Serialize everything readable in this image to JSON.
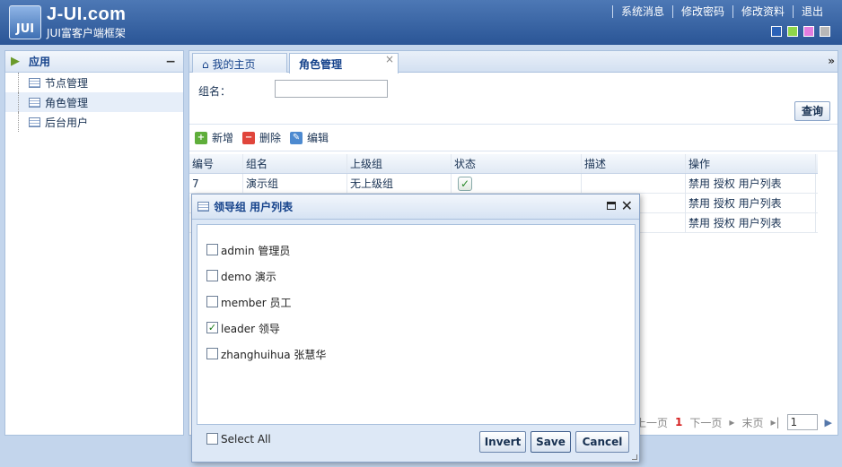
{
  "app": {
    "logo_mark": "JUI",
    "title": "J-UI.com",
    "subtitle": "JUI富客户端框架"
  },
  "top_nav": [
    "系统消息",
    "修改密码",
    "修改资料",
    "退出"
  ],
  "themes": [
    "#2a62b8",
    "#8ed64a",
    "#e37ddf",
    "#b8b8b8"
  ],
  "sidebar": {
    "title": "应用",
    "items": [
      {
        "label": "节点管理"
      },
      {
        "label": "角色管理"
      },
      {
        "label": "后台用户"
      }
    ]
  },
  "tabs": [
    {
      "label": "我的主页"
    },
    {
      "label": "角色管理"
    }
  ],
  "search": {
    "label": "组名：",
    "value": "",
    "query_label": "查询"
  },
  "toolbar": {
    "add_label": "新增",
    "delete_label": "删除",
    "edit_label": "编辑"
  },
  "grid": {
    "columns": [
      "编号",
      "组名",
      "上级组",
      "状态",
      "描述",
      "操作"
    ],
    "rows": [
      {
        "id": "7",
        "name": "演示组",
        "parent": "无上级组",
        "desc": "",
        "ops": "禁用 授权 用户列表"
      },
      {
        "id": "",
        "name": "",
        "parent": "",
        "desc": "",
        "ops": "禁用 授权 用户列表"
      },
      {
        "id": "",
        "name": "",
        "parent": "",
        "desc": "",
        "ops": "禁用 授权 用户列表"
      }
    ]
  },
  "pager": {
    "prev": "上一页",
    "current": "1",
    "next": "下一页",
    "last": "末页",
    "page_input": "1"
  },
  "dialog": {
    "title": "领导组 用户列表",
    "options": [
      {
        "label": "admin 管理员",
        "checked": false
      },
      {
        "label": "demo 演示",
        "checked": false
      },
      {
        "label": "member 员工",
        "checked": false
      },
      {
        "label": "leader 领导",
        "checked": true
      },
      {
        "label": "zhanghuihua 张慧华",
        "checked": false
      }
    ],
    "select_all": "Select All",
    "invert": "Invert",
    "save": "Save",
    "cancel": "Cancel"
  }
}
